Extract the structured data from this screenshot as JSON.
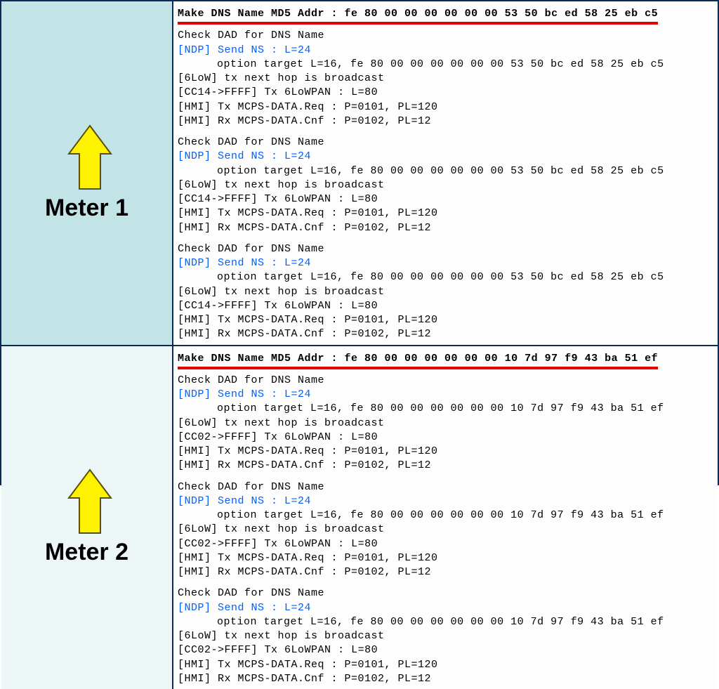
{
  "meters": [
    {
      "label": "Meter 1",
      "header": "Make DNS Name MD5 Addr : fe 80 00 00 00 00 00 00 53 50 bc ed 58 25 eb c5",
      "nodeId": "CC14",
      "addr": "fe 80 00 00 00 00 00 00 53 50 bc ed 58 25 eb c5",
      "checkTitle": "Check DAD for DNS Name",
      "ndpLine": "[NDP]  Send NS : L=24",
      "optionPrefix": "option target L=16,",
      "lowLine": "[6LoW] tx next hop is broadcast",
      "txLowpan": "Tx 6LoWPAN : L=80",
      "txReq": "[HMI]  Tx MCPS-DATA.Req : P=0101, PL=120",
      "rxCnf": "[HMI]  Rx MCPS-DATA.Cnf : P=0102, PL=12"
    },
    {
      "label": "Meter 2",
      "header": "Make DNS Name MD5 Addr : fe 80 00 00 00 00 00 00 10 7d 97 f9 43 ba 51 ef",
      "nodeId": "CC02",
      "addr": "fe 80 00 00 00 00 00 00 10 7d 97 f9 43 ba 51 ef",
      "checkTitle": "Check DAD for DNS Name",
      "ndpLine": "[NDP]  Send NS : L=24",
      "optionPrefix": "option target L=16,",
      "lowLine": "[6LoW] tx next hop is broadcast",
      "txLowpan": "Tx 6LoWPAN : L=80",
      "txReq": "[HMI]  Tx MCPS-DATA.Req : P=0101, PL=120",
      "rxCnf": "[HMI]  Rx MCPS-DATA.Cnf : P=0102, PL=12"
    }
  ]
}
